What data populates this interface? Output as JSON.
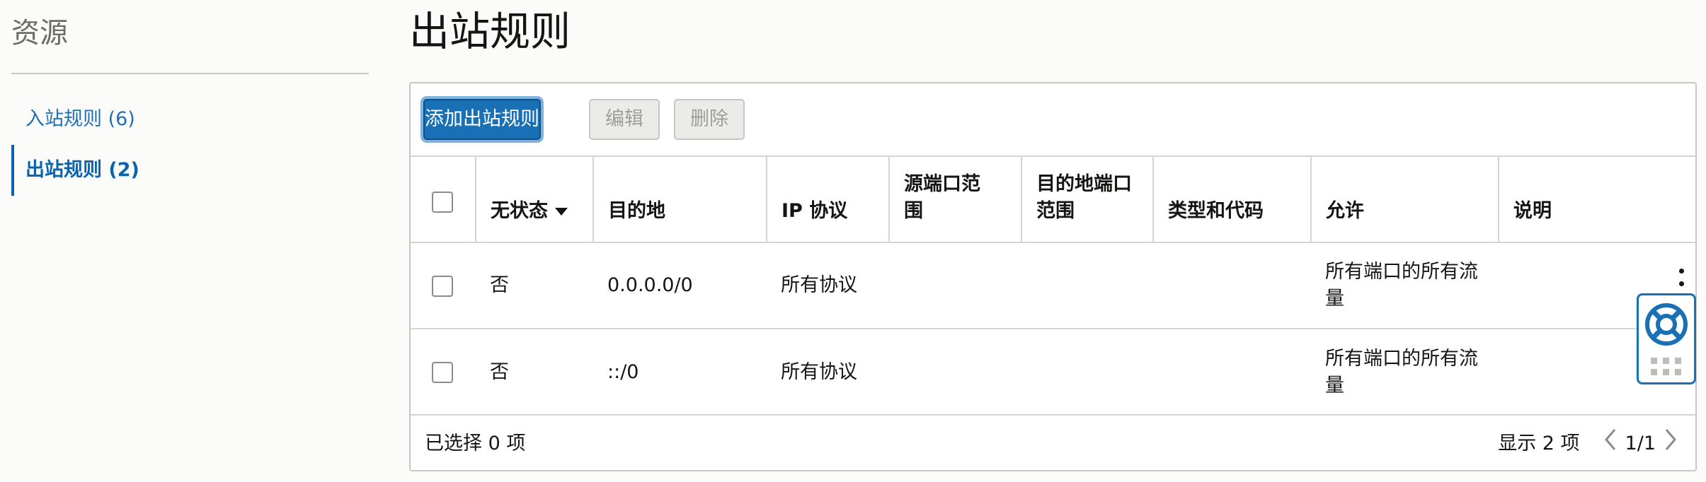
{
  "sidebar": {
    "title": "资源",
    "items": [
      {
        "label": "入站规则 (6)",
        "active": false
      },
      {
        "label": "出站规则 (2)",
        "active": true
      }
    ]
  },
  "page": {
    "title": "出站规则"
  },
  "toolbar": {
    "add_label": "添加出站规则",
    "edit_label": "编辑",
    "delete_label": "删除"
  },
  "table": {
    "columns": [
      {
        "label": "无状态",
        "sortable": true
      },
      {
        "label": "目的地"
      },
      {
        "label": "IP 协议"
      },
      {
        "label": "源端口范\n围"
      },
      {
        "label": "目的地端口\n范围"
      },
      {
        "label": "类型和代码"
      },
      {
        "label": "允许"
      },
      {
        "label": "说明"
      }
    ],
    "rows": [
      {
        "stateless": "否",
        "destination": "0.0.0.0/0",
        "protocol": "所有协议",
        "src_ports": "",
        "dst_ports": "",
        "type_code": "",
        "allows": "所有端口的所有流\n量",
        "description": ""
      },
      {
        "stateless": "否",
        "destination": "::/0",
        "protocol": "所有协议",
        "src_ports": "",
        "dst_ports": "",
        "type_code": "",
        "allows": "所有端口的所有流\n量",
        "description": ""
      }
    ]
  },
  "footer": {
    "selected_text": "已选择 0 项",
    "showing_text": "显示 2 项",
    "page_text": "1/1"
  },
  "icons": {
    "help": "lifebuoy-icon",
    "grip": "drag-grip-icon",
    "prev": "chevron-left-icon",
    "next": "chevron-right-icon",
    "sort": "sort-caret-icon",
    "row_actions": "kebab-menu-icon"
  },
  "colors": {
    "accent": "#1970b5",
    "link": "#1f6fb5",
    "border": "#c9c8c5",
    "background": "#fbfbfa"
  }
}
